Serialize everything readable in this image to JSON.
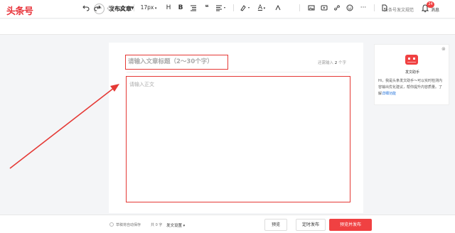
{
  "header": {
    "logo": "头条号",
    "back_icon": "arrow-left-icon",
    "title": "发布文章",
    "spec_link": "头条号发文规范",
    "bell_icon": "bell-icon",
    "badge_count": "24",
    "messages_label": "消息"
  },
  "toolbar": {
    "font_size": "17px",
    "icons": [
      "undo-icon",
      "redo-icon",
      "format-brush-icon",
      "clear-format-icon",
      "heading-icon",
      "bold-icon",
      "blockquote-icon",
      "quote-icon",
      "align-icon",
      "highlight-icon",
      "font-color-icon",
      "image-icon",
      "video-icon",
      "link-icon",
      "emoji-icon",
      "more-icon",
      "template-icon"
    ],
    "heading_glyph": "H",
    "bold_glyph": "B",
    "quote_glyph": "❝",
    "font_color_glyph": "A"
  },
  "editor": {
    "title_placeholder": "请输入文章标题（2～30个字）",
    "counter_prefix": "还需输入",
    "counter_value": "2",
    "counter_suffix": "个字",
    "body_placeholder": "请输入正文"
  },
  "assistant": {
    "name": "发文助手",
    "description": "Hi，我是头条发文助手～可以实时检测内容输出优化建议，帮你提升内容质量。了解",
    "link_text": "详细功能",
    "close_icon": "close-icon",
    "avatar_icon": "robot-icon"
  },
  "footer": {
    "draft_status": "草稿将自动保存",
    "word_count": "共 0 字",
    "settings_label": "发文设置",
    "preview_button": "预览",
    "schedule_button": "定时发布",
    "publish_button": "预览并发布"
  },
  "colors": {
    "brand": "#f04142",
    "annotation": "#e53935",
    "link": "#1e6fd9"
  }
}
